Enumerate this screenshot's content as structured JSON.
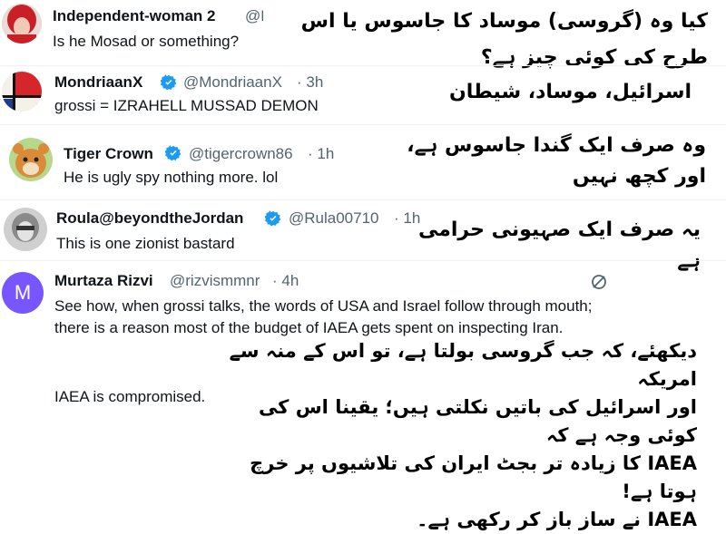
{
  "tweets": [
    {
      "name": "Independent-woman 2",
      "handle": "@F",
      "text": "Is he Mosad or something?",
      "translation": "کیا وہ (گروسی) موساد کا جاسوس یا اس طرح کی کوئی چیز ہے؟"
    },
    {
      "name": "MondriaanX",
      "handle": "@MondriaanX",
      "time": "· 3h",
      "text": "grossi =  IZRAHELL MUSSAD DEMON",
      "translation": "اسرائیل، موساد، شیطان"
    },
    {
      "name": "Tiger Crown",
      "handle": "@tigercrown86",
      "time": "· 1h",
      "text": "He is ugly spy nothing more. lol",
      "translation": "وہ صرف ایک گندا جاسوس ہے، اور کچھ نہیں"
    },
    {
      "name": "Roula@beyondtheJordan",
      "handle": "@Rula00710",
      "time": "· 1h",
      "text": "This is one zionist bastard",
      "translation": "یہ صرف ایک صہیونی حرامی ہے"
    },
    {
      "name": "Murtaza Rizvi",
      "handle": "@rizvismmnr",
      "time": "· 4h",
      "avatar_letter": "M",
      "text": "See how, when grossi talks, the words of USA and Israel follow through mouth; there is a reason most of the budget of IAEA gets spent on inspecting Iran.",
      "text2": "IAEA is compromised.",
      "translation_lines": [
        "دیکھئے، کہ جب گروسی بولتا ہے، تو اس کے منہ سے امریکہ",
        "اور اسرائیل کی باتیں نکلتی ہیں؛ یقینا اس کی کوئی وجہ ہے کہ",
        "IAEA کا زیادہ تر بجٹ ایران کی تلاشیوں پر خرچ ہوتا ہے!",
        "IAEA نے ساز باز کر رکھی ہے۔"
      ]
    }
  ],
  "colors": {
    "verified": "#1d9bf0",
    "handle": "#536471",
    "avatar_m": "#7856ff"
  },
  "icons": {
    "verified": "verified-badge-icon",
    "grok": "grok-icon"
  }
}
